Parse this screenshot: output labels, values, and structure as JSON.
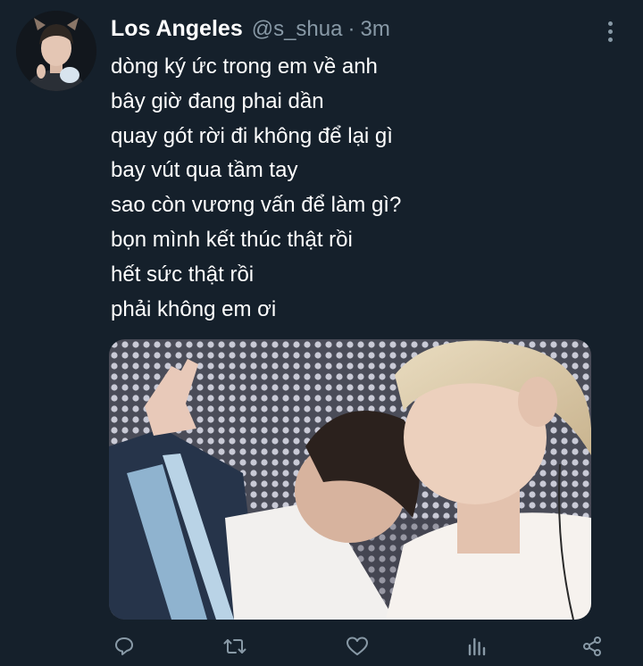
{
  "tweet": {
    "author_name": "Los Angeles",
    "handle": "@s_shua",
    "separator": "·",
    "time": "3m",
    "lines": [
      "dòng ký ức trong em về anh",
      "bây giờ đang phai dần",
      "quay gót rời đi không để lại gì",
      "bay vút qua tầm tay",
      "sao còn vương vấn để làm gì?",
      "bọn mình kết thúc thật rồi",
      "hết sức thật rồi",
      "phải không em ơi"
    ]
  },
  "icons": {
    "more": "more-vertical-icon",
    "reply": "reply-icon",
    "retweet": "retweet-icon",
    "like": "heart-icon",
    "analytics": "analytics-icon",
    "share": "share-icon"
  },
  "colors": {
    "background": "#15202b",
    "secondary_text": "#8899a6",
    "primary_text": "#ffffff"
  }
}
